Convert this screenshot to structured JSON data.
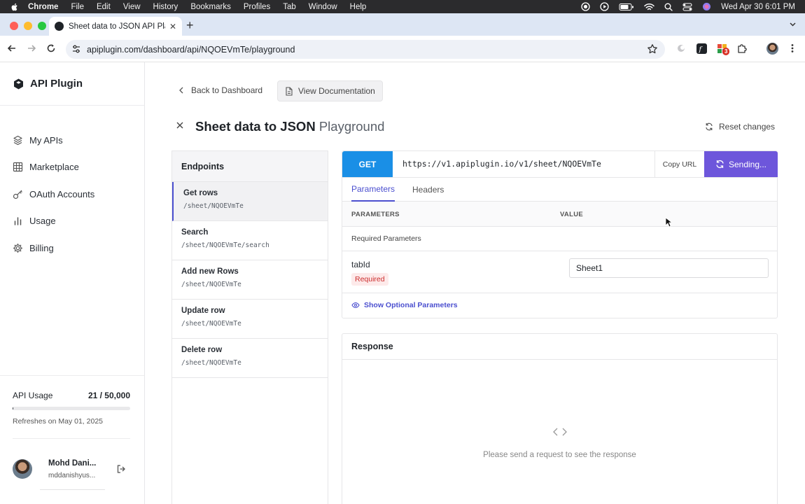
{
  "menubar": {
    "app": "Chrome",
    "items": [
      "File",
      "Edit",
      "View",
      "History",
      "Bookmarks",
      "Profiles",
      "Tab",
      "Window",
      "Help"
    ],
    "clock": "Wed Apr 30  6:01 PM"
  },
  "browser": {
    "tab_title": "Sheet data to JSON API Playg",
    "url": "apiplugin.com/dashboard/api/NQOEVmTe/playground",
    "extension_badge": "3"
  },
  "sidebar": {
    "brand": "API Plugin",
    "items": [
      {
        "label": "My APIs",
        "icon": "cube-stack-icon"
      },
      {
        "label": "Marketplace",
        "icon": "grid-icon"
      },
      {
        "label": "OAuth Accounts",
        "icon": "key-icon"
      },
      {
        "label": "Usage",
        "icon": "bar-chart-icon"
      },
      {
        "label": "Billing",
        "icon": "gear-icon"
      }
    ],
    "usage": {
      "label": "API Usage",
      "value": "21 / 50,000",
      "fraction": 0.00042,
      "refresh": "Refreshes on May 01, 2025"
    },
    "user": {
      "name": "Mohd Dani...",
      "email": "mddanishyus..."
    }
  },
  "main": {
    "back_label": "Back to Dashboard",
    "docs_label": "View Documentation",
    "title": "Sheet data to JSON",
    "title_suffix": "Playground",
    "reset_label": "Reset changes",
    "endpoints": {
      "heading": "Endpoints",
      "items": [
        {
          "name": "Get rows",
          "path": "/sheet/NQOEVmTe"
        },
        {
          "name": "Search",
          "path": "/sheet/NQOEVmTe/search"
        },
        {
          "name": "Add new Rows",
          "path": "/sheet/NQOEVmTe"
        },
        {
          "name": "Update row",
          "path": "/sheet/NQOEVmTe"
        },
        {
          "name": "Delete row",
          "path": "/sheet/NQOEVmTe"
        }
      ]
    },
    "request": {
      "method": "GET",
      "url": "https://v1.apiplugin.io/v1/sheet/NQOEVmTe",
      "copy_label": "Copy URL",
      "send_label": "Sending...",
      "tabs": [
        "Parameters",
        "Headers"
      ],
      "columns": [
        "PARAMETERS",
        "VALUE"
      ],
      "required_heading": "Required Parameters",
      "param": {
        "name": "tabId",
        "badge": "Required",
        "value": "Sheet1"
      },
      "optional_label": "Show Optional Parameters"
    },
    "response": {
      "heading": "Response",
      "empty": "Please send a request to see the response"
    }
  },
  "colors": {
    "accent": "#4b4fcf",
    "get": "#1a8fe6",
    "send": "#6d56db",
    "required": "#cc2e2e"
  }
}
